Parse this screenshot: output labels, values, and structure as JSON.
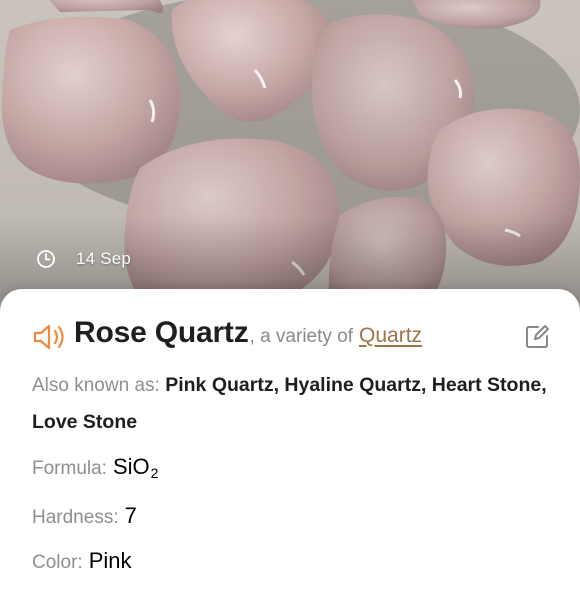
{
  "photo": {
    "description_icon": "clock-icon",
    "date": "14 Sep"
  },
  "header": {
    "name": "Rose Quartz",
    "variety_text": ", a variety of",
    "parent_link": "Quartz",
    "audio_icon": "speaker-icon",
    "edit_icon": "edit-icon",
    "accent_color": "#f08a3c",
    "link_color": "#a07447"
  },
  "properties": {
    "aka_label": "Also known as:",
    "aka_value": "Pink Quartz, Hyaline Quartz, Heart Stone, Love Stone",
    "formula_label": "Formula:",
    "formula_base": "SiO",
    "formula_sub": "2",
    "hardness_label": "Hardness:",
    "hardness_value": "7",
    "color_label": "Color:",
    "color_value": "Pink"
  }
}
